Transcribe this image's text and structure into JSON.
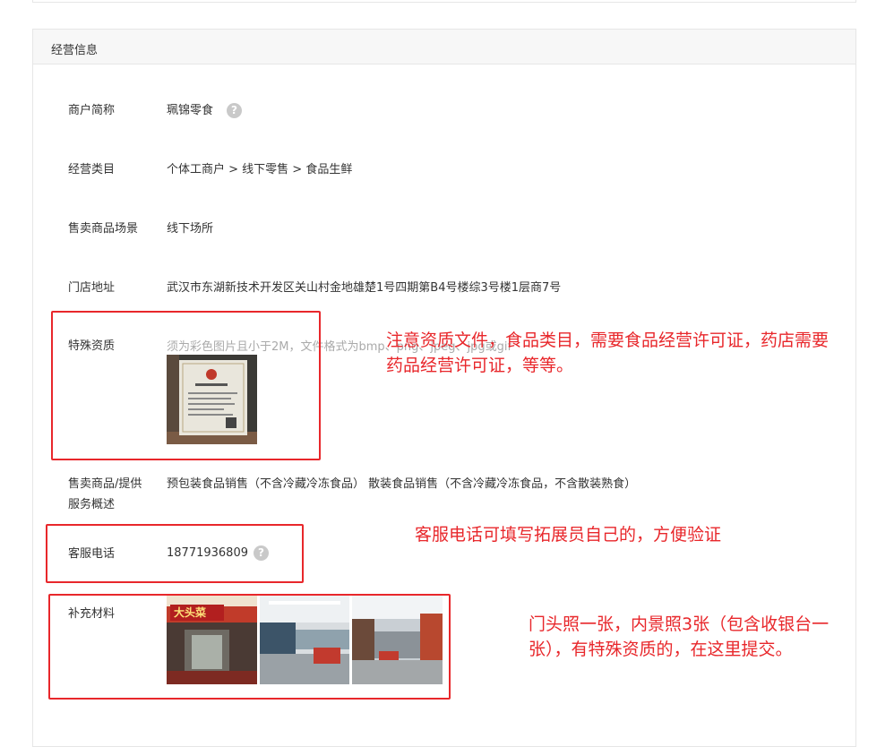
{
  "section": {
    "title": "经营信息"
  },
  "fields": {
    "merchant_name": {
      "label": "商户简称",
      "value": "珮锦零食"
    },
    "category": {
      "label": "经营类目",
      "value": "个体工商户 > 线下零售 > 食品生鲜"
    },
    "scene": {
      "label": "售卖商品场景",
      "value": "线下场所"
    },
    "address": {
      "label": "门店地址",
      "value": "武汉市东湖新技术开发区关山村金地雄楚1号四期第B4号楼综3号楼1层商7号"
    },
    "qualification": {
      "label": "特殊资质",
      "hint": "须为彩色图片且小于2M，文件格式为bmp、png、jpeg、jpg或gif"
    },
    "service_desc": {
      "label_line1": "售卖商品/提供",
      "label_line2": "服务概述",
      "value": "预包装食品销售（不含冷藏冷冻食品） 散装食品销售（不含冷藏冷冻食品，不含散装熟食）"
    },
    "phone": {
      "label": "客服电话",
      "value": "18771936809"
    },
    "materials": {
      "label": "补充材料"
    }
  },
  "help_glyph": "?",
  "store_sign_text": "大头菜",
  "annotations": {
    "qualification_note_line1": "注意资质文件，食品类目，需要食品经营许可证，药店需要",
    "qualification_note_line2": "药品经营许可证，等等。",
    "phone_note": "客服电话可填写拓展员自己的，方便验证",
    "materials_note_line1": "门头照一张，内景照3张（包含收银台一",
    "materials_note_line2": "张），有特殊资质的，在这里提交。"
  },
  "colors": {
    "annotation_red": "#e8272b",
    "help_gray": "#c9c9c9"
  }
}
